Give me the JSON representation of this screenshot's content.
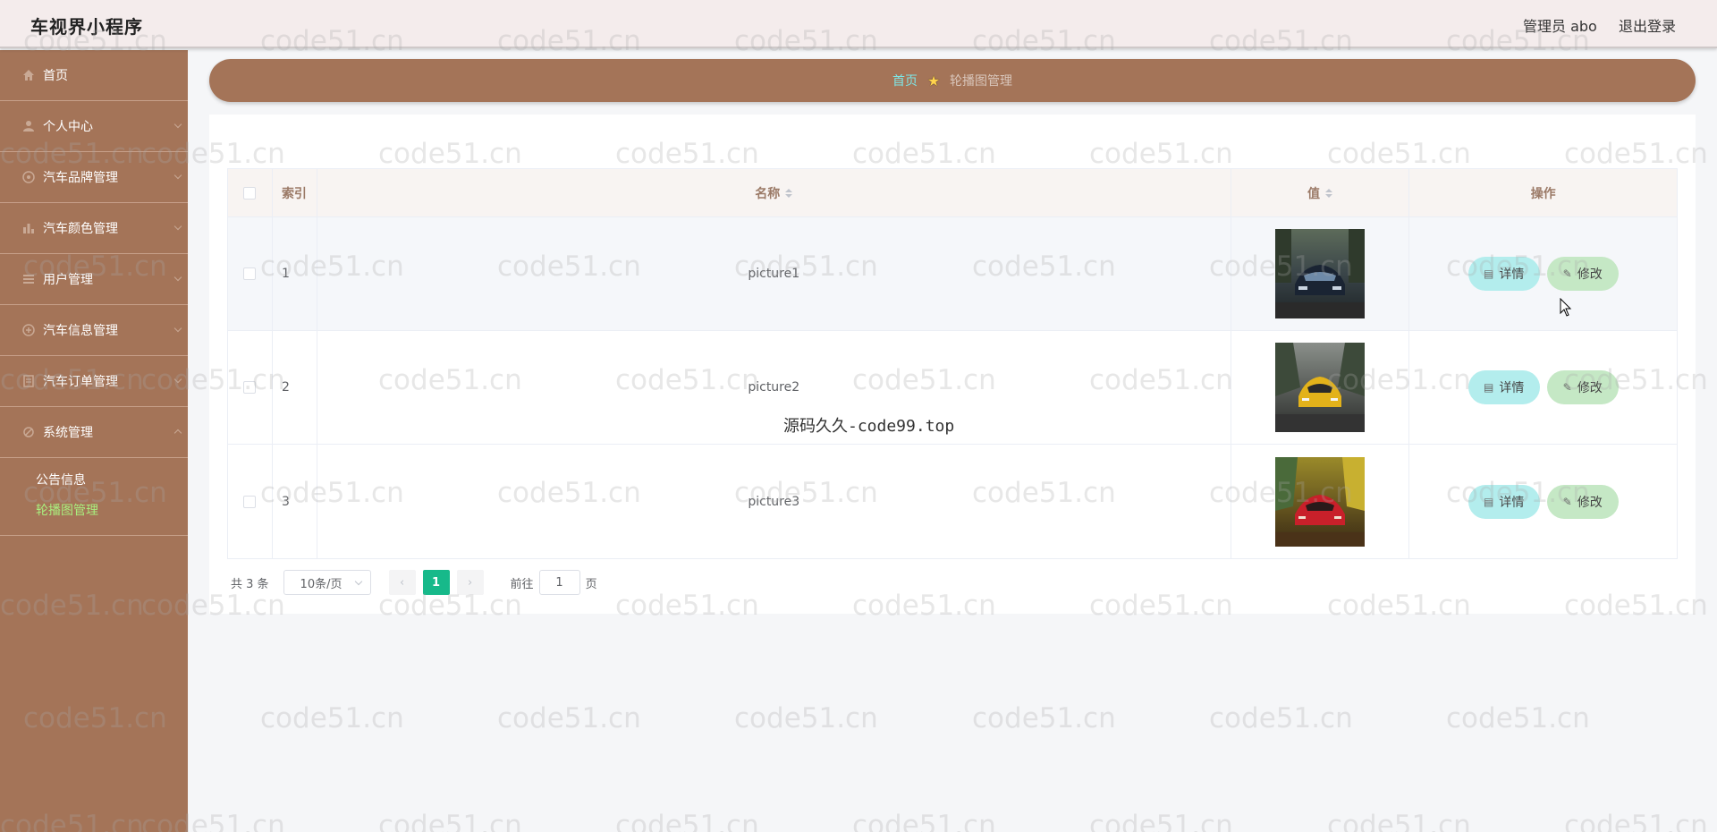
{
  "app": {
    "title": "车视界小程序"
  },
  "header": {
    "admin_label": "管理员 abo",
    "logout_label": "退出登录"
  },
  "sidebar": {
    "items": [
      {
        "label": "首页",
        "icon": "home-icon"
      },
      {
        "label": "个人中心",
        "icon": "user-icon"
      },
      {
        "label": "汽车品牌管理",
        "icon": "brand-icon"
      },
      {
        "label": "汽车颜色管理",
        "icon": "bar-chart-icon"
      },
      {
        "label": "用户管理",
        "icon": "list-icon"
      },
      {
        "label": "汽车信息管理",
        "icon": "info-icon"
      },
      {
        "label": "汽车订单管理",
        "icon": "order-icon"
      },
      {
        "label": "系统管理",
        "icon": "system-icon"
      }
    ],
    "submenu": [
      {
        "label": "公告信息",
        "active": false
      },
      {
        "label": "轮播图管理",
        "active": true
      }
    ]
  },
  "breadcrumb": {
    "home": "首页",
    "current": "轮播图管理"
  },
  "table": {
    "columns": {
      "index": "索引",
      "name": "名称",
      "value": "值",
      "actions": "操作"
    },
    "rows": [
      {
        "index": "1",
        "name": "picture1",
        "image": "dark-car"
      },
      {
        "index": "2",
        "name": "picture2",
        "image": "yellow-car"
      },
      {
        "index": "3",
        "name": "picture3",
        "image": "red-car"
      }
    ],
    "detail_label": "详情",
    "edit_label": "修改"
  },
  "pagination": {
    "total": "共 3 条",
    "page_size": "10条/页",
    "current_page": "1",
    "goto_label": "前往",
    "goto_value": "1",
    "page_unit": "页"
  },
  "watermark": {
    "text": "code51.cn",
    "center_text": "源码久久-code99.top"
  },
  "colors": {
    "sidebar": "#a47458",
    "accent_green": "#17b98a",
    "detail_btn": "#b3eded",
    "edit_btn": "#c5e8c5"
  }
}
